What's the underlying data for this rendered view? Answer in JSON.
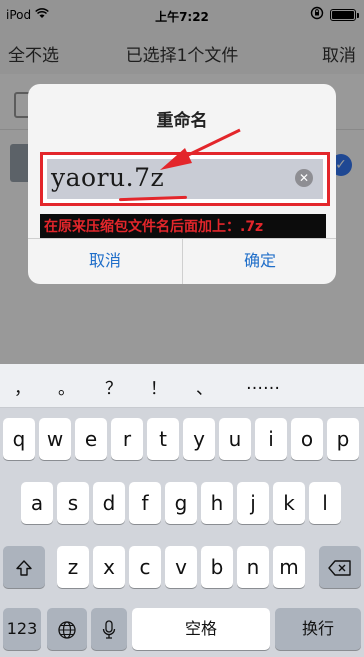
{
  "status_bar": {
    "carrier": "iPod",
    "time": "上午7:22"
  },
  "nav": {
    "left": "全不选",
    "title": "已选择1个文件",
    "right": "取消"
  },
  "dialog": {
    "title": "重命名",
    "input_value": "yaoru.7z",
    "annotation": "在原来压缩包文件名后面加上：.7z",
    "cancel": "取消",
    "confirm": "确定"
  },
  "keyboard": {
    "suggestions": [
      "，",
      "。",
      "？",
      "！",
      "、",
      "……"
    ],
    "row1": [
      "q",
      "w",
      "e",
      "r",
      "t",
      "y",
      "u",
      "i",
      "o",
      "p"
    ],
    "row2": [
      "a",
      "s",
      "d",
      "f",
      "g",
      "h",
      "j",
      "k",
      "l"
    ],
    "row3": [
      "z",
      "x",
      "c",
      "v",
      "b",
      "n",
      "m"
    ],
    "numbers": "123",
    "space": "空格",
    "return": "换行"
  },
  "colors": {
    "accent": "#1f6ec9",
    "highlight": "#e3262b"
  }
}
